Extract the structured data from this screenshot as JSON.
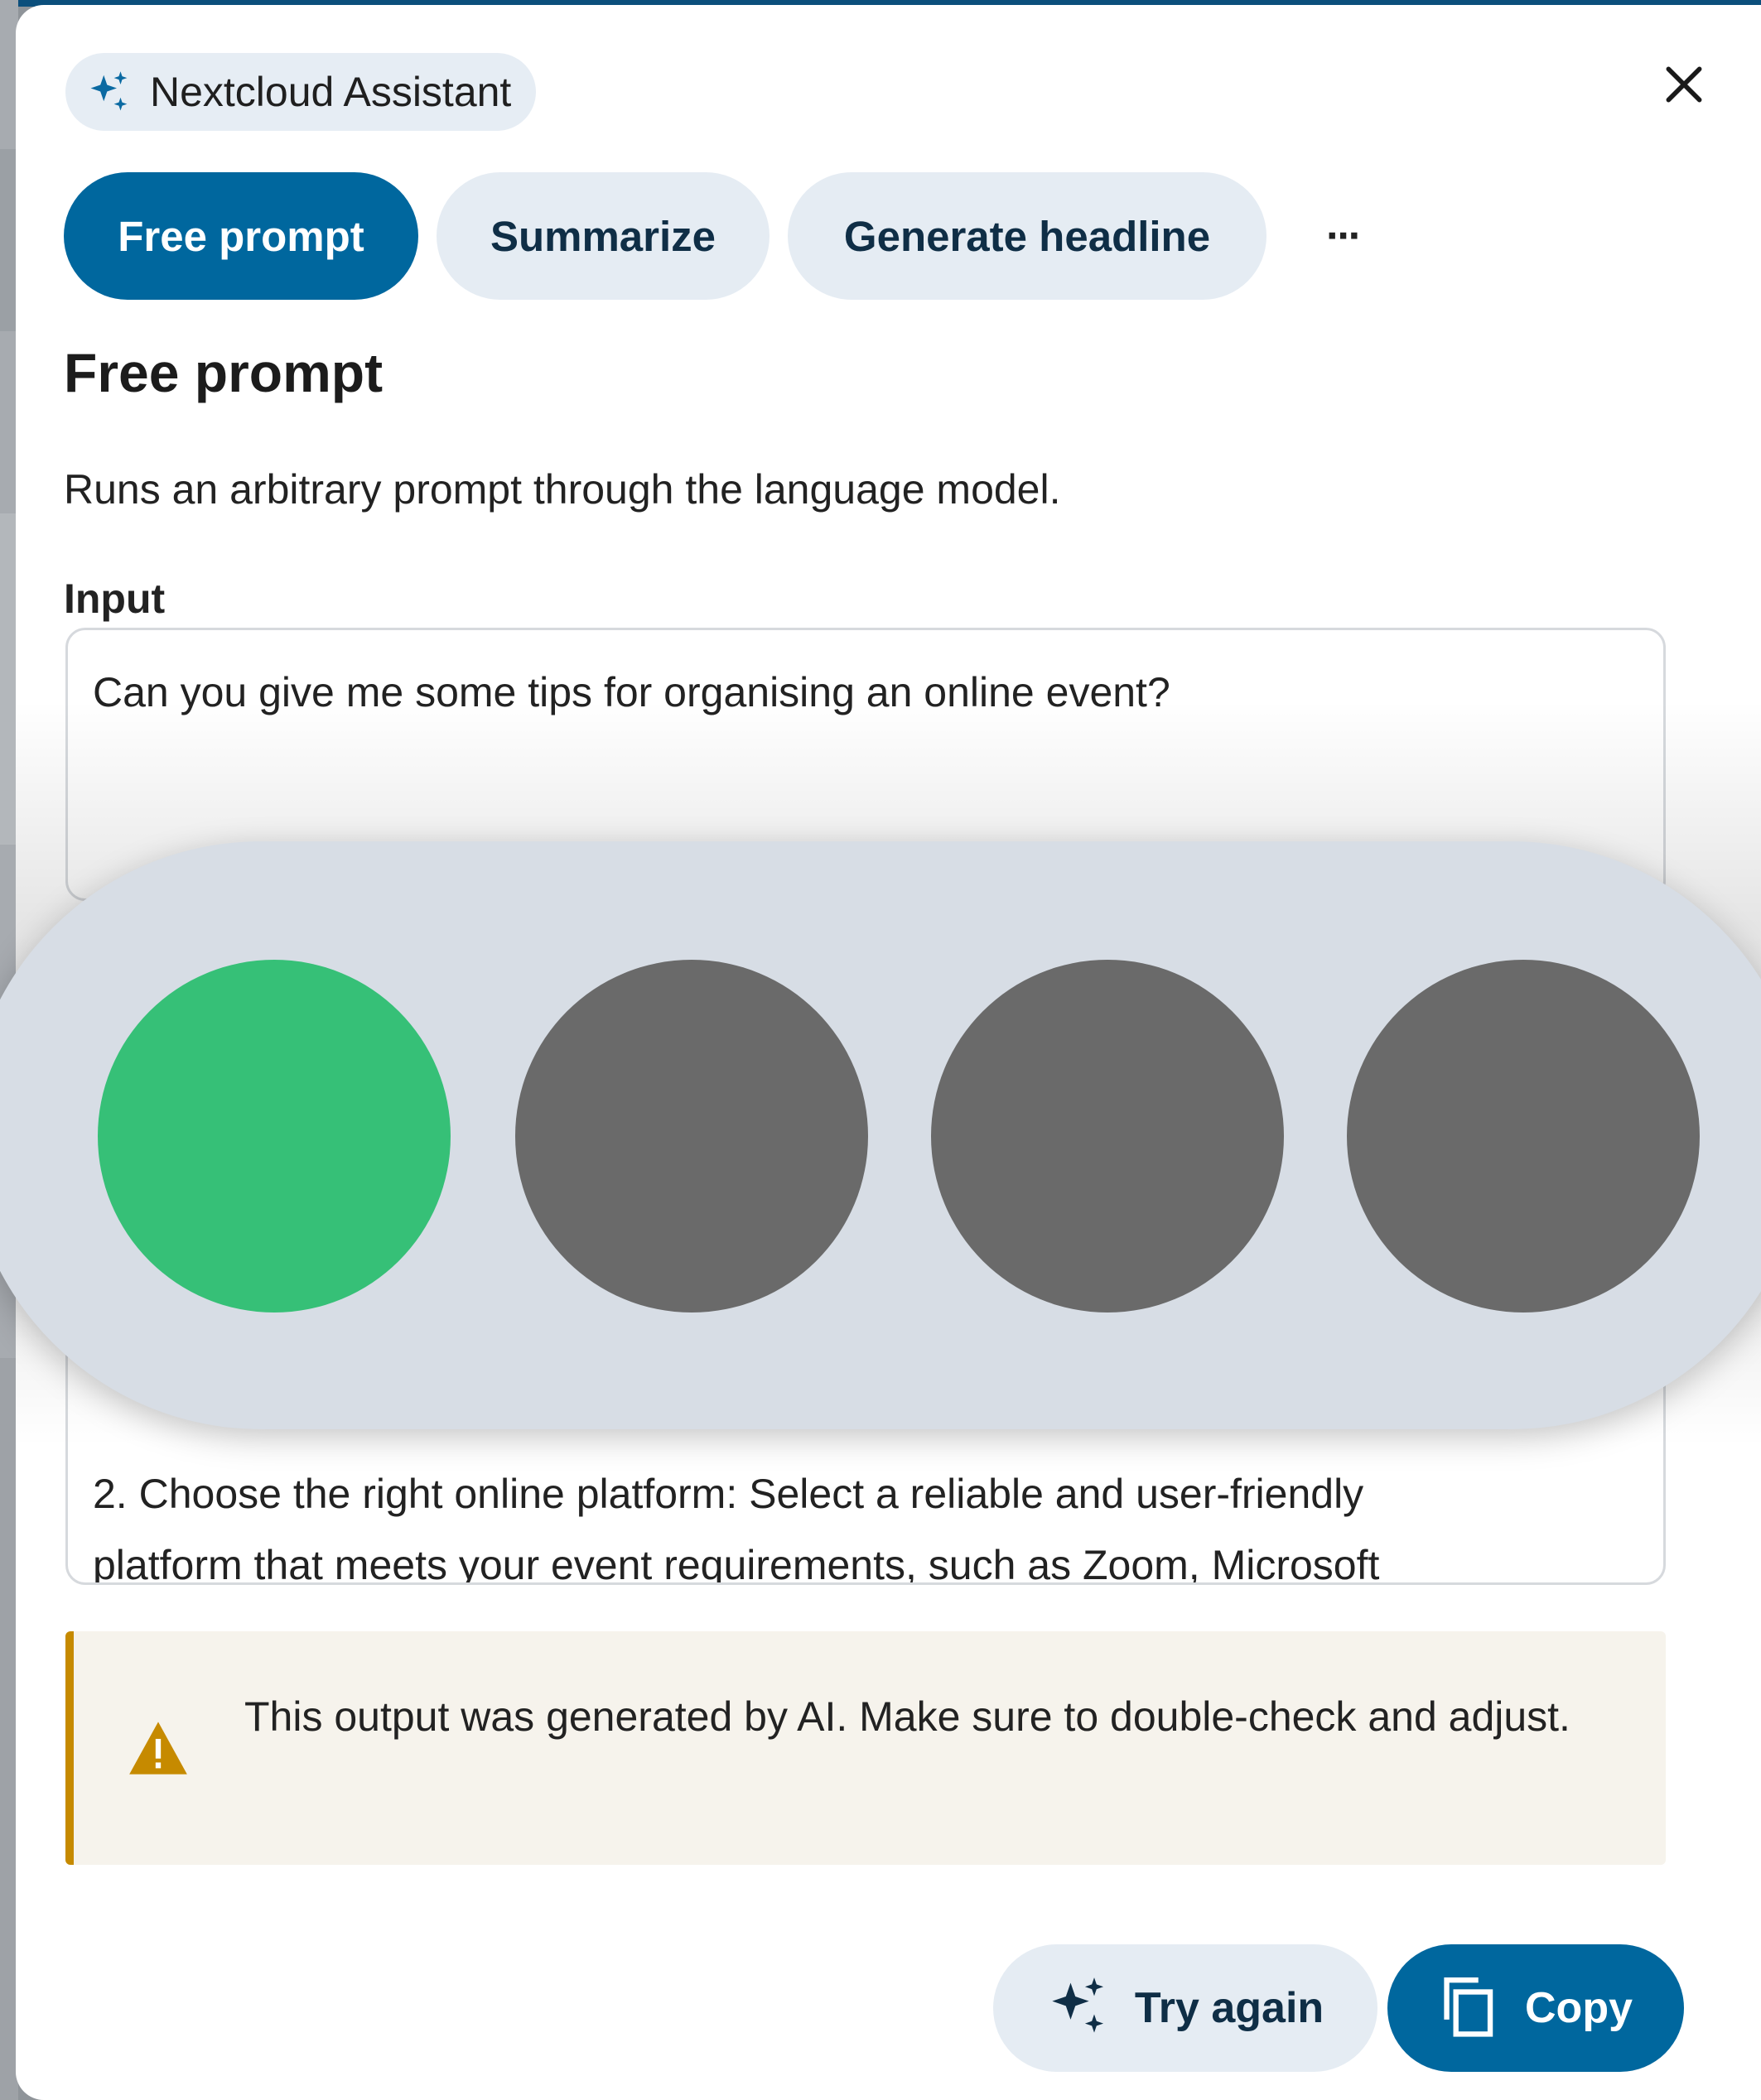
{
  "app": {
    "name": "Nextcloud Assistant"
  },
  "tabs": [
    {
      "label": "Free prompt",
      "active": true
    },
    {
      "label": "Summarize",
      "active": false
    },
    {
      "label": "Generate headline",
      "active": false
    }
  ],
  "more_label": "···",
  "task": {
    "title": "Free prompt",
    "description": "Runs an arbitrary prompt through the language model."
  },
  "input": {
    "label": "Input",
    "value": "Can you give me some tips for organising an online event?"
  },
  "output": {
    "lines": [
      "2. Choose the right online platform: Select a reliable and user-friendly",
      "platform that meets your event requirements, such as Zoom, Microsoft"
    ]
  },
  "warning": {
    "text": "This output was generated by AI. Make sure to double-check and adjust."
  },
  "actions": {
    "try_again_label": "Try again",
    "copy_label": "Copy"
  },
  "overlay": {
    "lights": [
      {
        "state": "on",
        "color": "#36c077"
      },
      {
        "state": "off",
        "color": "#6a6a6a"
      },
      {
        "state": "off",
        "color": "#6a6a6a"
      },
      {
        "state": "off",
        "color": "#6a6a6a"
      }
    ]
  },
  "colors": {
    "primary": "#00679e",
    "secondary_bg": "#e5ecf3",
    "warning_accent": "#c68a00",
    "warning_bg": "#f6f3ec"
  }
}
